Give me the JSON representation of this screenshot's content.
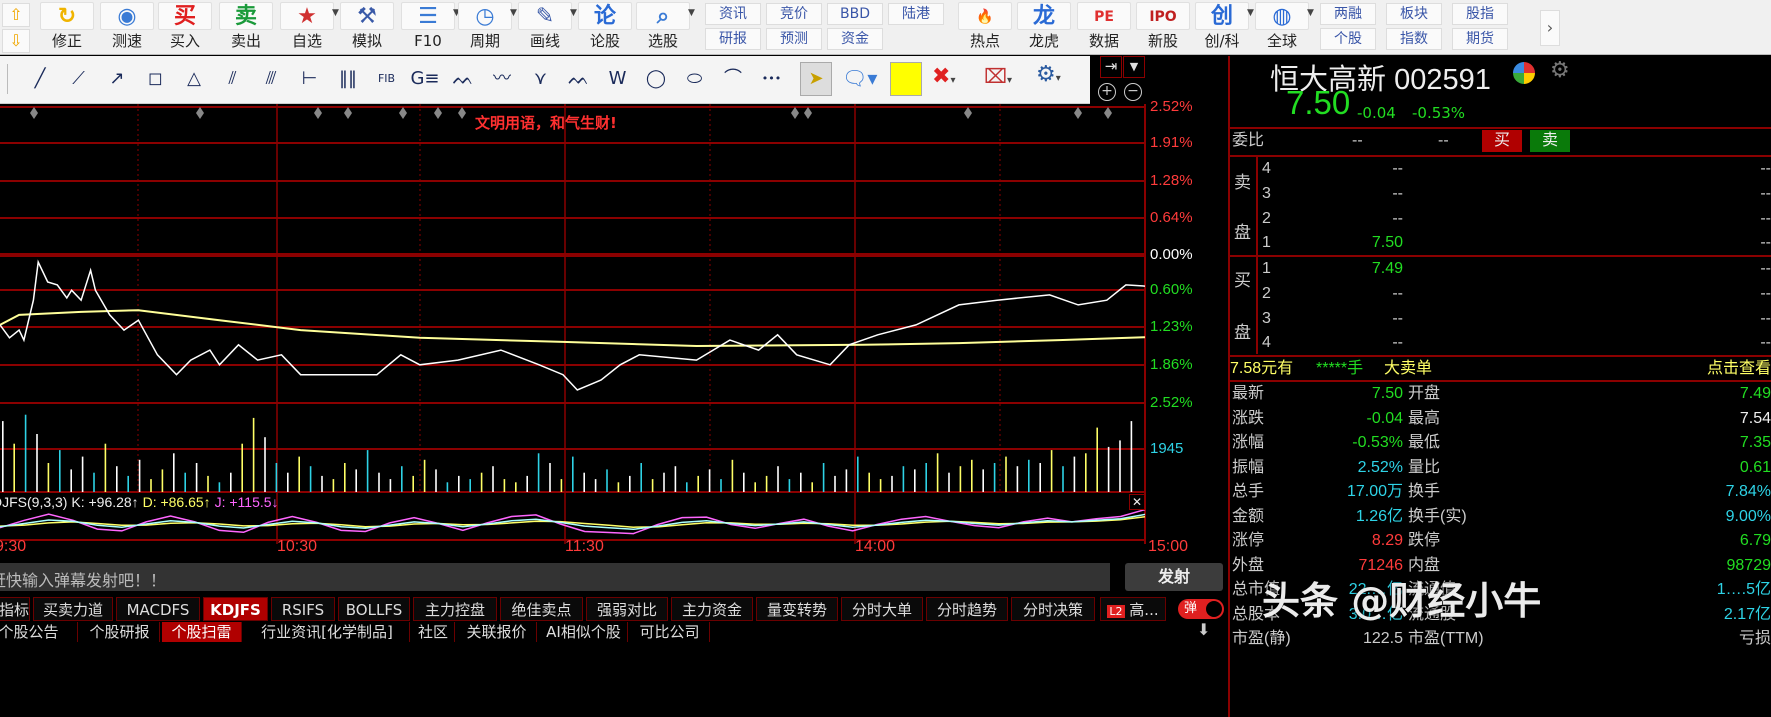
{
  "toolbar": {
    "main": [
      {
        "label": "修正",
        "icon": "refresh-icon",
        "glyph": "↻",
        "color": "#f0b400"
      },
      {
        "label": "测速",
        "icon": "stopwatch-icon",
        "glyph": "◉",
        "color": "#3a7bd5"
      },
      {
        "label": "买入",
        "icon": "buy-icon",
        "glyph": "买",
        "color": "#e02020"
      },
      {
        "label": "卖出",
        "icon": "sell-icon",
        "glyph": "卖",
        "color": "#1a9a3a"
      },
      {
        "label": "自选",
        "icon": "folder-star-icon",
        "glyph": "★",
        "color": "#d03030",
        "dropdown": true
      },
      {
        "label": "模拟",
        "icon": "gavel-icon",
        "glyph": "⚒",
        "color": "#3a5aa8"
      },
      {
        "label": "F10",
        "icon": "document-icon",
        "glyph": "☰",
        "color": "#3a7bd5",
        "dropdown": true
      },
      {
        "label": "周期",
        "icon": "clock-icon",
        "glyph": "◷",
        "color": "#3a7bd5",
        "dropdown": true
      },
      {
        "label": "画线",
        "icon": "pencil-icon",
        "glyph": "✎",
        "color": "#3a5aa8",
        "dropdown": true
      },
      {
        "label": "论股",
        "icon": "discuss-icon",
        "glyph": "论",
        "color": "#2a6ad5"
      },
      {
        "label": "选股",
        "icon": "magnifier-chart-icon",
        "glyph": "⌕",
        "color": "#3a7bd5",
        "dropdown": true
      }
    ],
    "grid1": [
      [
        "资讯",
        "研报"
      ],
      [
        "竞价",
        "预测"
      ],
      [
        "BBD",
        "资金"
      ],
      [
        "陆港",
        ""
      ]
    ],
    "main2": [
      {
        "label": "热点",
        "icon": "hot-icon",
        "glyph": "🔥",
        "color": "#e03030"
      },
      {
        "label": "龙虎",
        "icon": "dragon-icon",
        "glyph": "龙",
        "color": "#2a6ad5"
      },
      {
        "label": "数据",
        "icon": "pe-data-icon",
        "glyph": "PE",
        "color": "#e03030"
      },
      {
        "label": "新股",
        "icon": "ipo-icon",
        "glyph": "IPO",
        "color": "#c02020"
      },
      {
        "label": "创/科",
        "icon": "chuang-icon",
        "glyph": "创",
        "color": "#2a6ad5",
        "dropdown": true
      },
      {
        "label": "全球",
        "icon": "globe-icon",
        "glyph": "◍",
        "color": "#2a6ad5",
        "dropdown": true
      }
    ],
    "grid2": [
      [
        "两融",
        "个股"
      ],
      [
        "板块",
        "指数"
      ],
      [
        "股指",
        "期货"
      ]
    ]
  },
  "drawing_tools": [
    "line-tool",
    "segment-tool",
    "ray-tool",
    "rectangle-tool",
    "triangle-tool",
    "fan-tool",
    "parallel-tool",
    "measure-tool",
    "period-lines-tool",
    "fib-time-tool",
    "gann-tool",
    "wave-tool-1",
    "wave-tool-2",
    "wave-tool-3",
    "wave-tool-4",
    "wave-tool-5",
    "circle-tool",
    "ellipse-tool",
    "arc-tool",
    "more-tool"
  ],
  "chart": {
    "banner": "文明用语，和气生财!",
    "price_axis": [
      "2.52%",
      "1.91%",
      "1.28%",
      "0.64%",
      "0.00%",
      "0.60%",
      "1.23%",
      "1.86%",
      "2.52%"
    ],
    "volume_label": "1945",
    "time_axis": [
      "9:30",
      "10:30",
      "11:30",
      "14:00",
      "15:00"
    ],
    "kdj": {
      "name": "DJFS(9,3,3)",
      "k": "K: +96.28↑",
      "d": "D: +86.65↑",
      "j": "J: +115.5↓"
    },
    "colors": {
      "price": "#ffffff",
      "avg": "#ffff99",
      "grid": "#8b0000",
      "up_axis": "#ff3b3b",
      "down_axis": "#22dd22"
    }
  },
  "chart_data": {
    "type": "line",
    "x_unit": "time",
    "y_unit": "percent change",
    "ylim": [
      -2.52,
      2.52
    ],
    "price": [
      [
        "09:30",
        -1.19
      ],
      [
        "09:32",
        -1.41
      ],
      [
        "09:34",
        -1.28
      ],
      [
        "09:35",
        -1.45
      ],
      [
        "09:37",
        -0.77
      ],
      [
        "09:38",
        -0.12
      ],
      [
        "09:40",
        -0.46
      ],
      [
        "09:42",
        -0.51
      ],
      [
        "09:44",
        -0.73
      ],
      [
        "09:45",
        -0.6
      ],
      [
        "09:47",
        -0.77
      ],
      [
        "09:49",
        -0.26
      ],
      [
        "09:50",
        -0.6
      ],
      [
        "09:53",
        -1.02
      ],
      [
        "09:56",
        -1.28
      ],
      [
        "09:59",
        -1.11
      ],
      [
        "10:03",
        -1.7
      ],
      [
        "10:07",
        -2.04
      ],
      [
        "10:10",
        -1.79
      ],
      [
        "10:14",
        -1.62
      ],
      [
        "10:16",
        -1.87
      ],
      [
        "10:20",
        -1.53
      ],
      [
        "10:24",
        -1.79
      ],
      [
        "10:29",
        -1.7
      ],
      [
        "10:33",
        -2.04
      ],
      [
        "10:41",
        -2.04
      ],
      [
        "10:49",
        -2.04
      ],
      [
        "10:54",
        -1.7
      ],
      [
        "10:58",
        -1.87
      ],
      [
        "11:06",
        -1.79
      ],
      [
        "11:15",
        -1.62
      ],
      [
        "11:23",
        -1.87
      ],
      [
        "11:28",
        -2.04
      ],
      [
        "13:01",
        -2.3
      ],
      [
        "13:06",
        -2.13
      ],
      [
        "13:10",
        -1.87
      ],
      [
        "13:14",
        -1.7
      ],
      [
        "13:26",
        -1.79
      ],
      [
        "13:33",
        -1.45
      ],
      [
        "13:39",
        -1.62
      ],
      [
        "13:43",
        -1.36
      ],
      [
        "13:47",
        -1.7
      ],
      [
        "13:54",
        -1.87
      ],
      [
        "13:58",
        -1.53
      ],
      [
        "14:04",
        -1.36
      ],
      [
        "14:12",
        -1.19
      ],
      [
        "14:21",
        -0.85
      ],
      [
        "14:29",
        -0.77
      ],
      [
        "14:40",
        -0.68
      ],
      [
        "14:46",
        -0.85
      ],
      [
        "14:52",
        -0.77
      ],
      [
        "14:56",
        -0.51
      ],
      [
        "15:00",
        -0.53
      ]
    ],
    "average": [
      [
        "09:30",
        -1.19
      ],
      [
        "09:34",
        -1.02
      ],
      [
        "09:47",
        -0.97
      ],
      [
        "09:59",
        -0.94
      ],
      [
        "10:16",
        -1.11
      ],
      [
        "10:33",
        -1.28
      ],
      [
        "10:58",
        -1.41
      ],
      [
        "11:28",
        -1.48
      ],
      [
        "13:26",
        -1.55
      ],
      [
        "14:01",
        -1.53
      ],
      [
        "14:21",
        -1.5
      ],
      [
        "14:42",
        -1.45
      ],
      [
        "15:00",
        -1.4
      ]
    ],
    "volume": [
      2200,
      1500,
      2400,
      1800,
      900,
      1300,
      700,
      1100,
      600,
      1500,
      800,
      500,
      1000,
      400,
      700,
      1200,
      600,
      900,
      500,
      300,
      600,
      1500,
      2300,
      1700,
      900,
      600,
      1100,
      800,
      500,
      400,
      900,
      700,
      1300,
      600,
      400,
      800,
      500,
      1000,
      700,
      300,
      500,
      400,
      600,
      800,
      400,
      300,
      500,
      1200,
      900,
      400,
      1100,
      600,
      400,
      700,
      300,
      500,
      900,
      400,
      600,
      800,
      300,
      500,
      700,
      400,
      1000,
      600,
      300,
      500,
      800,
      400,
      600,
      300,
      900,
      500,
      700,
      1100,
      600,
      400,
      500,
      800,
      700,
      900,
      1200,
      600,
      800,
      1000,
      700,
      900,
      1100,
      800,
      1000,
      900,
      1300,
      800,
      1100,
      1200,
      2000,
      1400,
      1600,
      2200
    ],
    "volume_colors": "wycwycwwcywcwyywcwycwyywcwycwyywcwwcyywcwcywyywcwycwwcywcywwcywcywyywcwycwwcyywcwcywyywcywcwycwyyww",
    "kdj_k": [
      50,
      62,
      75,
      70,
      55,
      48,
      60,
      72,
      66,
      52,
      45,
      58,
      70,
      64,
      50,
      44,
      56,
      68,
      62,
      50,
      60,
      72,
      78,
      66,
      52,
      46,
      40,
      52,
      66,
      72,
      62,
      54,
      60,
      68,
      58,
      48,
      56,
      66,
      74,
      70,
      62,
      56,
      64,
      72,
      68,
      74,
      80,
      96
    ],
    "kdj_d": [
      52,
      56,
      64,
      68,
      62,
      55,
      56,
      63,
      65,
      60,
      53,
      54,
      61,
      63,
      57,
      50,
      52,
      60,
      62,
      57,
      58,
      64,
      70,
      69,
      62,
      55,
      48,
      49,
      57,
      65,
      64,
      59,
      59,
      63,
      61,
      55,
      55,
      60,
      67,
      70,
      66,
      61,
      62,
      67,
      68,
      71,
      76,
      87
    ]
  },
  "quote": {
    "name": "恒大高新",
    "code": "002591",
    "price": "7.50",
    "change": "-0.04",
    "change_pct": "-0.53%",
    "weibi_label": "委比",
    "weibi_1": "--",
    "weibi_2": "--",
    "buy_btn": "买",
    "sell_btn": "卖",
    "sell_label": [
      "卖",
      "盘"
    ],
    "buy_label": [
      "买",
      "盘"
    ],
    "asks": [
      {
        "lv": "4",
        "price": "--",
        "vol": "--"
      },
      {
        "lv": "3",
        "price": "--",
        "vol": "--"
      },
      {
        "lv": "2",
        "price": "--",
        "vol": "--"
      },
      {
        "lv": "1",
        "price": "7.50",
        "vol": "--"
      }
    ],
    "bids": [
      {
        "lv": "1",
        "price": "7.49",
        "vol": "--"
      },
      {
        "lv": "2",
        "price": "--",
        "vol": "--"
      },
      {
        "lv": "3",
        "price": "--",
        "vol": "--"
      },
      {
        "lv": "4",
        "price": "--",
        "vol": "--"
      }
    ],
    "big_order": {
      "a": "7.58元有",
      "b": "*****手",
      "c": "大卖单",
      "link": "点击查看"
    },
    "stats": [
      {
        "l1": "最新",
        "v1": "7.50",
        "c1": "g",
        "l2": "开盘",
        "v2": "7.49",
        "c2": "g"
      },
      {
        "l1": "涨跌",
        "v1": "-0.04",
        "c1": "g",
        "l2": "最高",
        "v2": "7.54",
        "c2": "w"
      },
      {
        "l1": "涨幅",
        "v1": "-0.53%",
        "c1": "g",
        "l2": "最低",
        "v2": "7.35",
        "c2": "g"
      },
      {
        "l1": "振幅",
        "v1": "2.52%",
        "c1": "c",
        "l2": "量比",
        "v2": "0.61",
        "c2": "g"
      },
      {
        "l1": "总手",
        "v1": "17.00万",
        "c1": "c",
        "l2": "换手",
        "v2": "7.84%",
        "c2": "c"
      },
      {
        "l1": "金额",
        "v1": "1.26亿",
        "c1": "c",
        "l2": "换手(实)",
        "v2": "9.00%",
        "c2": "c"
      },
      {
        "l1": "涨停",
        "v1": "8.29",
        "c1": "r",
        "l2": "跌停",
        "v2": "6.79",
        "c2": "g"
      },
      {
        "l1": "外盘",
        "v1": "71246",
        "c1": "r",
        "l2": "内盘",
        "v2": "98729",
        "c2": "g"
      },
      {
        "l1": "总市值",
        "v1": "22.…亿",
        "c1": "c",
        "l2": "流通值",
        "v2": "1….5亿",
        "c2": "c"
      },
      {
        "l1": "总股本",
        "v1": "3.0…亿",
        "c1": "c",
        "l2": "流通股",
        "v2": "2.17亿",
        "c2": "c"
      },
      {
        "l1": "市盈(静)",
        "v1": "122.5",
        "c1": "gr",
        "l2": "市盈(TTM)",
        "v2": "亏损",
        "c2": "gr"
      }
    ]
  },
  "danmaku": {
    "placeholder": "赶快输入弹幕发射吧！！",
    "send": "发射",
    "toggle": "弹"
  },
  "tabs": [
    "指标",
    "买卖力道",
    "MACDFS",
    "KDJFS",
    "RSIFS",
    "BOLLFS",
    "主力控盘",
    "绝佳卖点",
    "强弱对比",
    "主力资金",
    "量变转势",
    "分时大单",
    "分时趋势",
    "分时决策"
  ],
  "tabs_active": "KDJFS",
  "l2_tab": {
    "badge": "L2",
    "label": "高..."
  },
  "bottom_tabs": [
    "个股公告",
    "个股研报",
    "个股扫雷",
    "行业资讯[化学制品]",
    "社区",
    "关联报价",
    "AI相似个股",
    "可比公司"
  ],
  "bottom_active": "个股扫雷",
  "watermark": "头条 @财经小牛"
}
